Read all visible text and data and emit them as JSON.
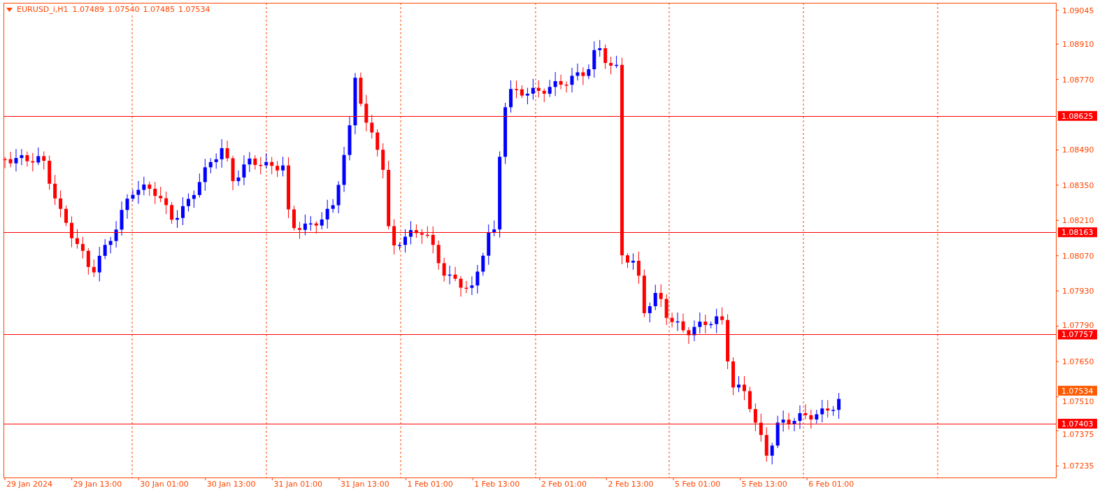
{
  "chart": {
    "symbol": "EURUSD_i,H1",
    "ohlc": [
      "1.07489",
      "1.07540",
      "1.07485",
      "1.07534"
    ],
    "price_axis": [
      "1.09045",
      "1.08910",
      "1.08770",
      "1.08490",
      "1.08350",
      "1.08210",
      "1.08070",
      "1.07930",
      "1.07790",
      "1.07650",
      "1.07510",
      "1.07375",
      "1.07235"
    ],
    "levels": [
      {
        "price": "1.08625"
      },
      {
        "price": "1.08163"
      },
      {
        "price": "1.07757"
      },
      {
        "price": "1.07403"
      }
    ],
    "current_price": "1.07534",
    "time_axis": [
      "29 Jan 2024",
      "29 Jan 13:00",
      "30 Jan 01:00",
      "30 Jan 13:00",
      "31 Jan 01:00",
      "31 Jan 13:00",
      "1 Feb 01:00",
      "1 Feb 13:00",
      "2 Feb 01:00",
      "2 Feb 13:00",
      "5 Feb 01:00",
      "5 Feb 13:00",
      "6 Feb 01:00"
    ]
  }
}
